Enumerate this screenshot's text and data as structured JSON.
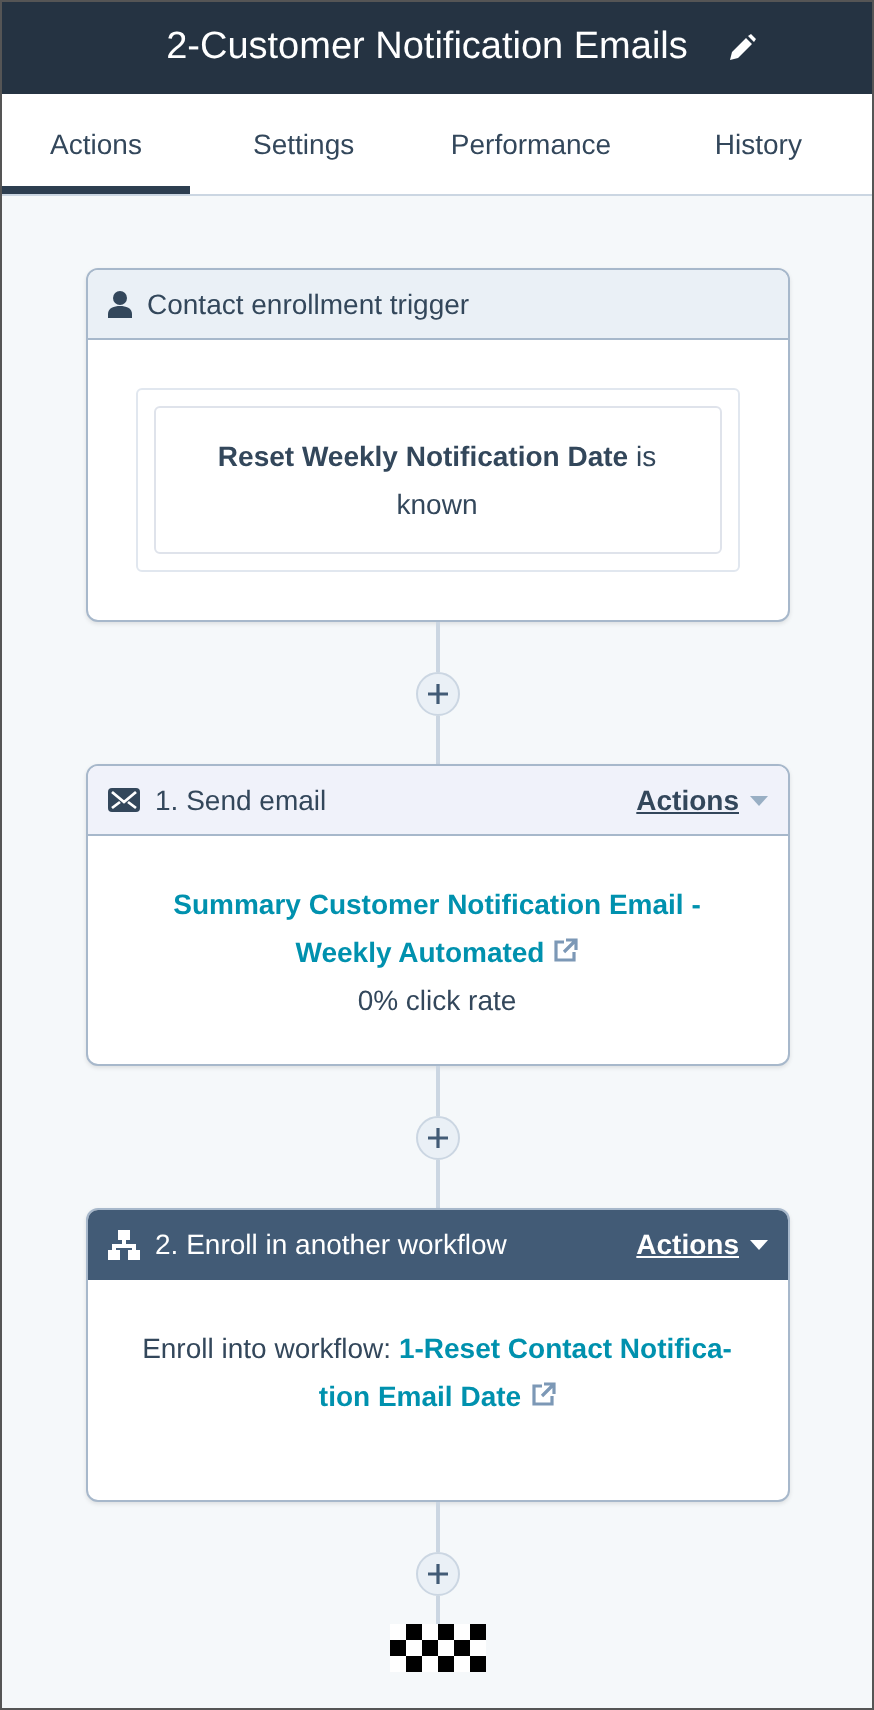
{
  "header": {
    "title": "2-Customer Notification Emails"
  },
  "tabs": [
    {
      "label": "Actions",
      "selected": true
    },
    {
      "label": "Settings",
      "selected": false
    },
    {
      "label": "Performance",
      "selected": false
    },
    {
      "label": "History",
      "selected": false
    }
  ],
  "steps": [
    {
      "kind": "trigger",
      "title": "Contact enrollment trigger",
      "condition": "**Reset Weekly Notification Date** is known"
    },
    {
      "kind": "email",
      "title": "1. Send email",
      "selected": false,
      "menu": "Actions",
      "link": "Summary Customer Notification Email - Weekly Automated",
      "stat": "0% click rate"
    },
    {
      "kind": "workflow",
      "title": "2. Enroll in another workflow",
      "selected": true,
      "menu": "Actions",
      "label": "Enroll into workflow:",
      "link": "1-Reset Contact Notifica-tion Email Date"
    }
  ]
}
